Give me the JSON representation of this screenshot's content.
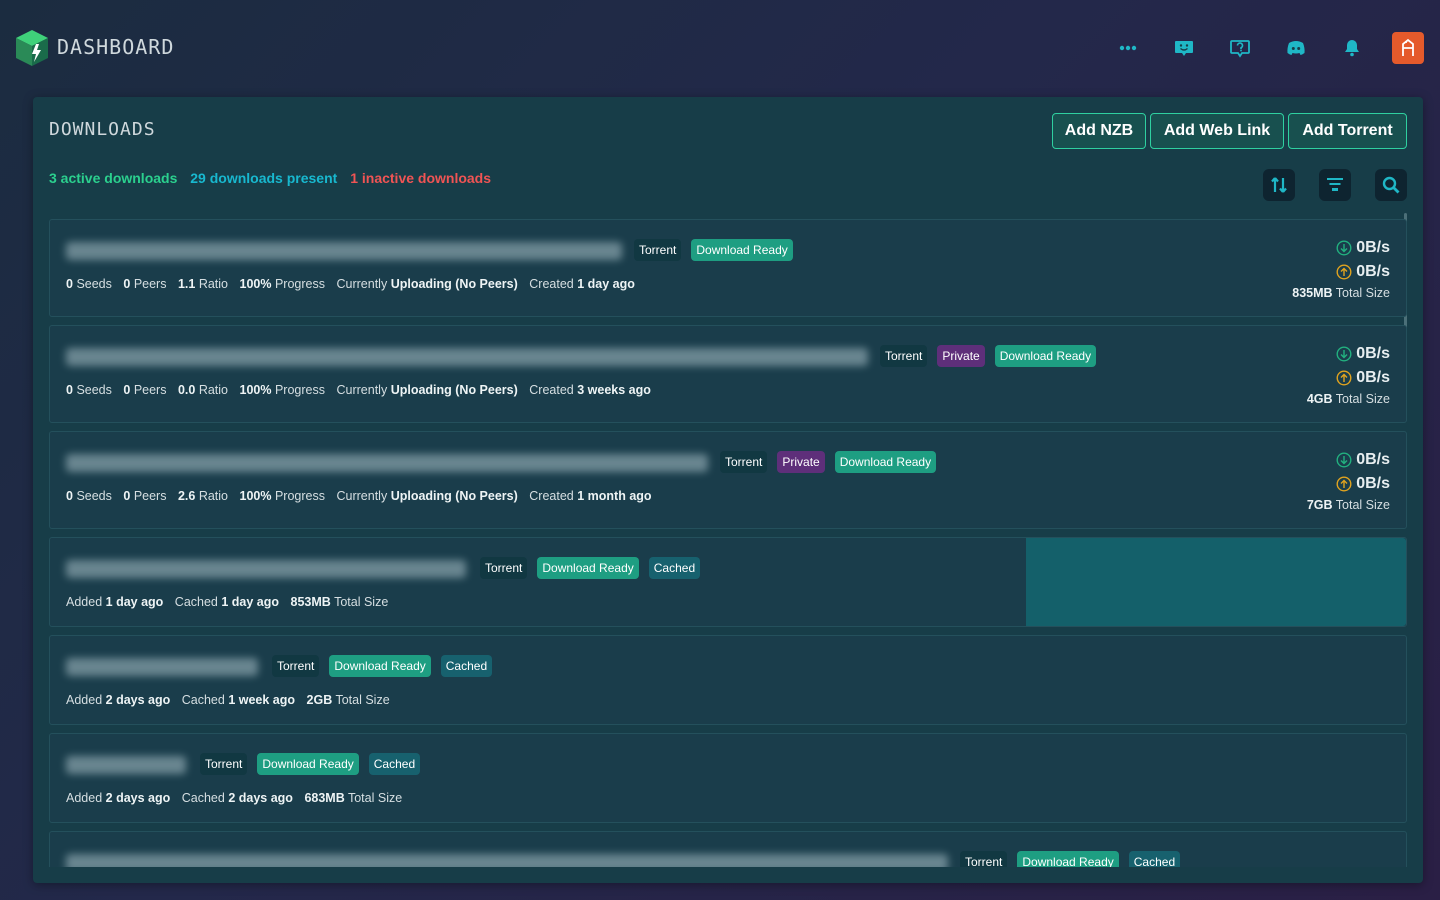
{
  "header": {
    "brand": "DASHBOARD",
    "icons": [
      "more-icon",
      "support-icon",
      "ideas-icon",
      "discord-icon",
      "notifications-icon"
    ],
    "avatar_letter": "A",
    "avatar_color": "#e55a2b"
  },
  "panel": {
    "title": "DOWNLOADS",
    "buttons": {
      "add_nzb": "Add NZB",
      "add_web_link": "Add Web Link",
      "add_torrent": "Add Torrent"
    },
    "stats": {
      "active": "3 active downloads",
      "present": "29 downloads present",
      "inactive": "1 inactive downloads"
    },
    "tools": [
      "sort-icon",
      "filter-icon",
      "search-icon"
    ]
  },
  "labels": {
    "seeds": "Seeds",
    "peers": "Peers",
    "ratio": "Ratio",
    "progress": "Progress",
    "currently": "Currently",
    "created": "Created",
    "added": "Added",
    "cached": "Cached",
    "total_size": "Total Size"
  },
  "active_items": [
    {
      "seeds": "0",
      "peers": "0",
      "ratio": "1.1",
      "progress": "100%",
      "status": "Uploading (No Peers)",
      "created": "1 day ago",
      "tags": [
        "Torrent",
        "Download Ready"
      ],
      "down": "0B/s",
      "up": "0B/s",
      "size": "835MB"
    },
    {
      "seeds": "0",
      "peers": "0",
      "ratio": "0.0",
      "progress": "100%",
      "status": "Uploading (No Peers)",
      "created": "3 weeks ago",
      "tags": [
        "Torrent",
        "Private",
        "Download Ready"
      ],
      "down": "0B/s",
      "up": "0B/s",
      "size": "4GB"
    },
    {
      "seeds": "0",
      "peers": "0",
      "ratio": "2.6",
      "progress": "100%",
      "status": "Uploading (No Peers)",
      "created": "1 month ago",
      "tags": [
        "Torrent",
        "Private",
        "Download Ready"
      ],
      "down": "0B/s",
      "up": "0B/s",
      "size": "7GB"
    }
  ],
  "cached_items": [
    {
      "added": "1 day ago",
      "cached": "1 day ago",
      "size": "853MB",
      "tags": [
        "Torrent",
        "Download Ready",
        "Cached"
      ],
      "progress": 0.28
    },
    {
      "added": "2 days ago",
      "cached": "1 week ago",
      "size": "2GB",
      "tags": [
        "Torrent",
        "Download Ready",
        "Cached"
      ]
    },
    {
      "added": "2 days ago",
      "cached": "2 days ago",
      "size": "683MB",
      "tags": [
        "Torrent",
        "Download Ready",
        "Cached"
      ]
    },
    {
      "tags": [
        "Torrent",
        "Download Ready",
        "Cached"
      ]
    }
  ],
  "colors": {
    "active": "#2bd08e",
    "present": "#18b8cf",
    "inactive": "#f05454",
    "ready": "#1e9e82",
    "private": "#5e2f7a",
    "cached": "#17616e"
  }
}
